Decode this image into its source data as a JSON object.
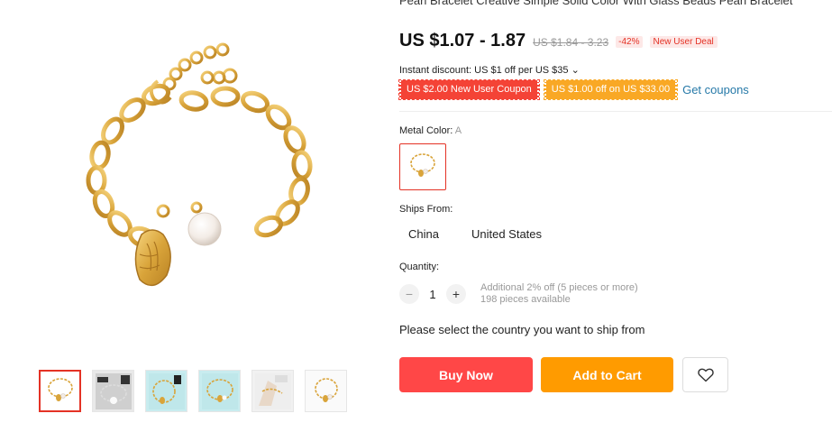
{
  "product": {
    "title": "Pearl Bracelet Creative Simple Solid Color With Glass Beads Pearl Bracelet",
    "price": "US $1.07 - 1.87",
    "original_price": "US $1.84 - 3.23",
    "discount_badge": "-42%",
    "new_user_badge": "New User Deal",
    "instant_discount": "Instant discount: US $1 off per US $35 ⌄",
    "coupons": [
      {
        "label": "US $2.00 New User Coupon",
        "color": "#f44336"
      },
      {
        "label": "US $1.00 off on US $33.00",
        "color": "#f9a825"
      }
    ],
    "get_coupons_label": "Get coupons"
  },
  "options": {
    "metal_color_label": "Metal Color:",
    "metal_color_value": "A",
    "ships_from_label": "Ships From:",
    "ships_from": [
      "China",
      "United States"
    ]
  },
  "quantity": {
    "label": "Quantity:",
    "minus": "−",
    "plus": "+",
    "value": "1",
    "additional_discount": "Additional 2% off (5 pieces or more)",
    "available": "198 pieces available"
  },
  "ship_note": "Please select the country you want to ship from",
  "actions": {
    "buy_now": "Buy Now",
    "add_to_cart": "Add to Cart",
    "wishlist_icon": "heart-icon"
  },
  "gallery": {
    "thumbnail_count": 6,
    "active_index": 0
  },
  "colors": {
    "accent_red": "#ff4747",
    "accent_orange": "#ff9b00",
    "link_blue": "#2679a8",
    "gold": "#e0b34a"
  }
}
